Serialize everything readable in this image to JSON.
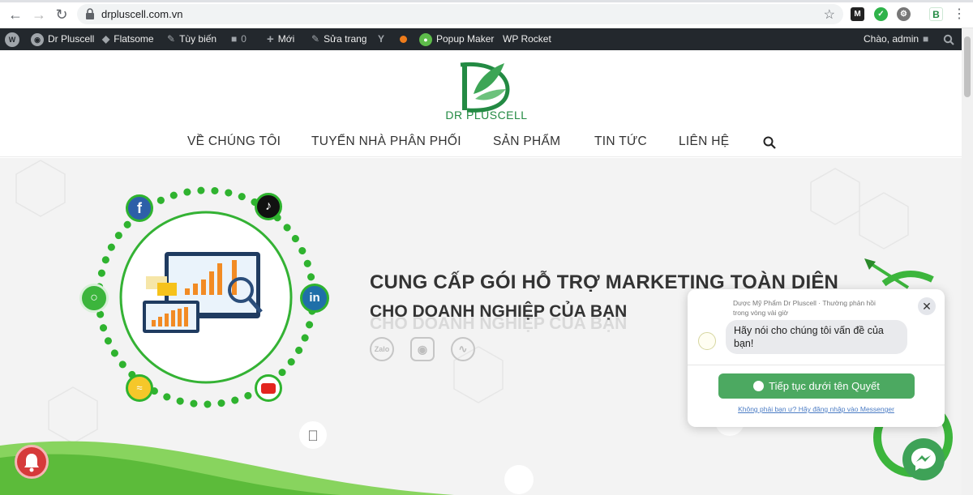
{
  "browser": {
    "url": "drpluscell.com.vn"
  },
  "admin_bar": {
    "site_name": "Dr Pluscell",
    "flatsome": "Flatsome",
    "customize": "Tùy biến",
    "comments_count": "0",
    "new_label": "Mới",
    "edit_page": "Sửa trang",
    "popup_maker": "Popup Maker",
    "wp_rocket": "WP Rocket",
    "greeting": "Chào, admin"
  },
  "header": {
    "logo_text": "DR PLUSCELL",
    "nav": [
      "VỀ CHÚNG TÔI",
      "TUYỂN NHÀ PHÂN PHỐI",
      "SẢN PHẨM",
      "TIN TỨC",
      "LIÊN HỆ"
    ]
  },
  "hero": {
    "title": "CUNG CẤP GÓI HỖ TRỢ MARKETING TOÀN DIỆN",
    "subtitle": "CHO DOANH NGHIỆP CỦA BẠN",
    "zalo_label": "Zalo"
  },
  "messenger": {
    "page_name": "Dược Mỹ Phẩm Dr Pluscell",
    "response_time": "Thường phản hồi trong vòng vài giờ",
    "message": "Hãy nói cho chúng tôi vấn đề của bạn!",
    "continue_button": "Tiếp tục dưới tên Quyết",
    "not_you_link": "Không phải bạn ư? Hãy đăng nhập vào Messenger"
  },
  "colors": {
    "brand_green": "#238a43",
    "admin_bar": "#23282d",
    "messenger_green": "#4ca961"
  }
}
